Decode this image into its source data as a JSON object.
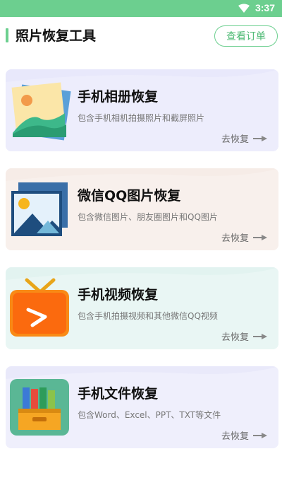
{
  "status_bar": {
    "time": "3:37"
  },
  "header": {
    "title": "照片恢复工具",
    "orders_button": "查看订单"
  },
  "cards": [
    {
      "title": "手机相册恢复",
      "desc": "包含手机相机拍摄照片和截屏照片",
      "action": "去恢复",
      "icon": "photo-album-icon"
    },
    {
      "title": "微信QQ图片恢复",
      "desc": "包含微信图片、朋友圈图片和QQ图片",
      "action": "去恢复",
      "icon": "picture-frame-icon"
    },
    {
      "title": "手机视频恢复",
      "desc": "包含手机拍摄视频和其他微信QQ视频",
      "action": "去恢复",
      "icon": "tv-play-icon"
    },
    {
      "title": "手机文件恢复",
      "desc": "包含Word、Excel、PPT、TXT等文件",
      "action": "去恢复",
      "icon": "file-box-icon"
    }
  ],
  "colors": {
    "accent": "#6ccf8f",
    "card1_bg": "#e6e6fb",
    "card2_bg": "#f7ede8",
    "card3_bg": "#e3f4f1",
    "card4_bg": "#eaeafb"
  }
}
